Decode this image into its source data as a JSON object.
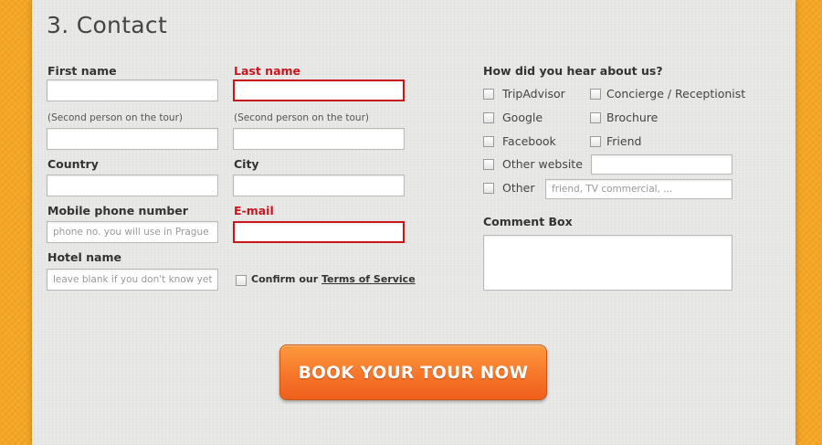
{
  "section_title": "3. Contact",
  "form": {
    "first_name_label": "First name",
    "last_name_label": "Last name",
    "second_person_note_1": "(Second person on the tour)",
    "second_person_note_2": "(Second person on the tour)",
    "country_label": "Country",
    "city_label": "City",
    "mobile_label": "Mobile phone number",
    "mobile_placeholder": "phone no. you will use in Prague",
    "email_label": "E-mail",
    "hotel_label": "Hotel name",
    "hotel_placeholder": "leave blank if you don't know yet",
    "confirm_prefix": "Confirm our ",
    "terms_link": "Terms of Service"
  },
  "hear": {
    "heading": "How did you hear about us?",
    "options": {
      "tripadvisor": "TripAdvisor",
      "concierge": "Concierge / Receptionist",
      "google": "Google",
      "brochure": "Brochure",
      "facebook": "Facebook",
      "friend": "Friend",
      "other_website": "Other website",
      "other": "Other"
    },
    "other_placeholder": "friend, TV commercial, ..."
  },
  "comment_label": "Comment Box",
  "submit_label": "BOOK YOUR TOUR NOW",
  "colors": {
    "background": "#f6a623",
    "panel": "#e6e6e4",
    "required": "#c8161d",
    "button": "#f7762a"
  }
}
